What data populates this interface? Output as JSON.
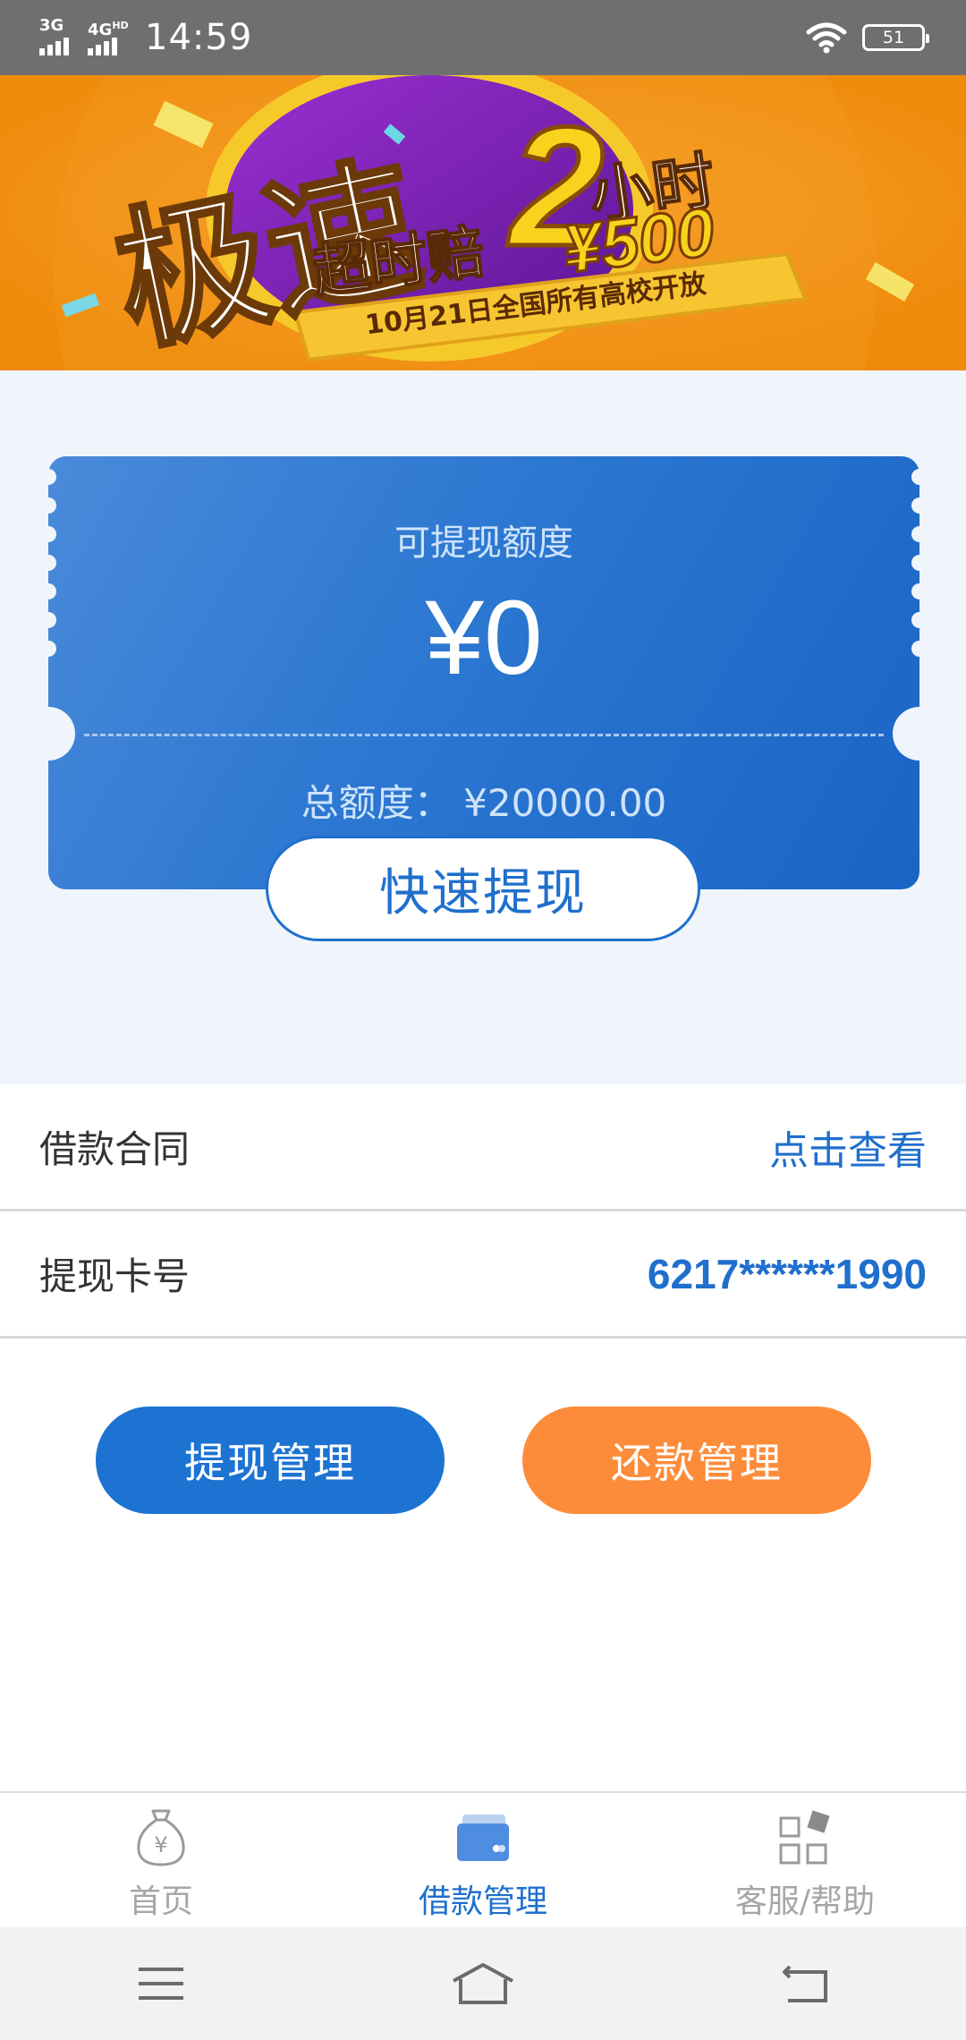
{
  "status_bar": {
    "network1": "3G",
    "network2": "4G",
    "network2_sup": "HD",
    "time": "14:59",
    "battery": "51"
  },
  "banner": {
    "text_big": "极速",
    "text_number": "2",
    "text_hours": "小时",
    "text_compensate": "超时赔",
    "text_amount": "¥500",
    "text_ribbon": "10月21日全国所有高校开放"
  },
  "credit_card": {
    "available_label": "可提现额度",
    "available_amount": "¥0",
    "total_label": "总额度：",
    "total_amount": "¥20000.00",
    "quick_withdraw_label": "快速提现"
  },
  "info_rows": [
    {
      "label": "借款合同",
      "value": "点击查看"
    },
    {
      "label": "提现卡号",
      "value": "6217******1990"
    }
  ],
  "actions": {
    "withdraw_manage": "提现管理",
    "repay_manage": "还款管理"
  },
  "tabs": [
    {
      "label": "首页",
      "icon": "money-bag-icon",
      "active": false
    },
    {
      "label": "借款管理",
      "icon": "card-icon",
      "active": true
    },
    {
      "label": "客服/帮助",
      "icon": "grid-icon",
      "active": false
    }
  ],
  "colors": {
    "primary": "#1f6fcd",
    "accent": "#fd8c3a",
    "banner_bg": "#f79413"
  }
}
